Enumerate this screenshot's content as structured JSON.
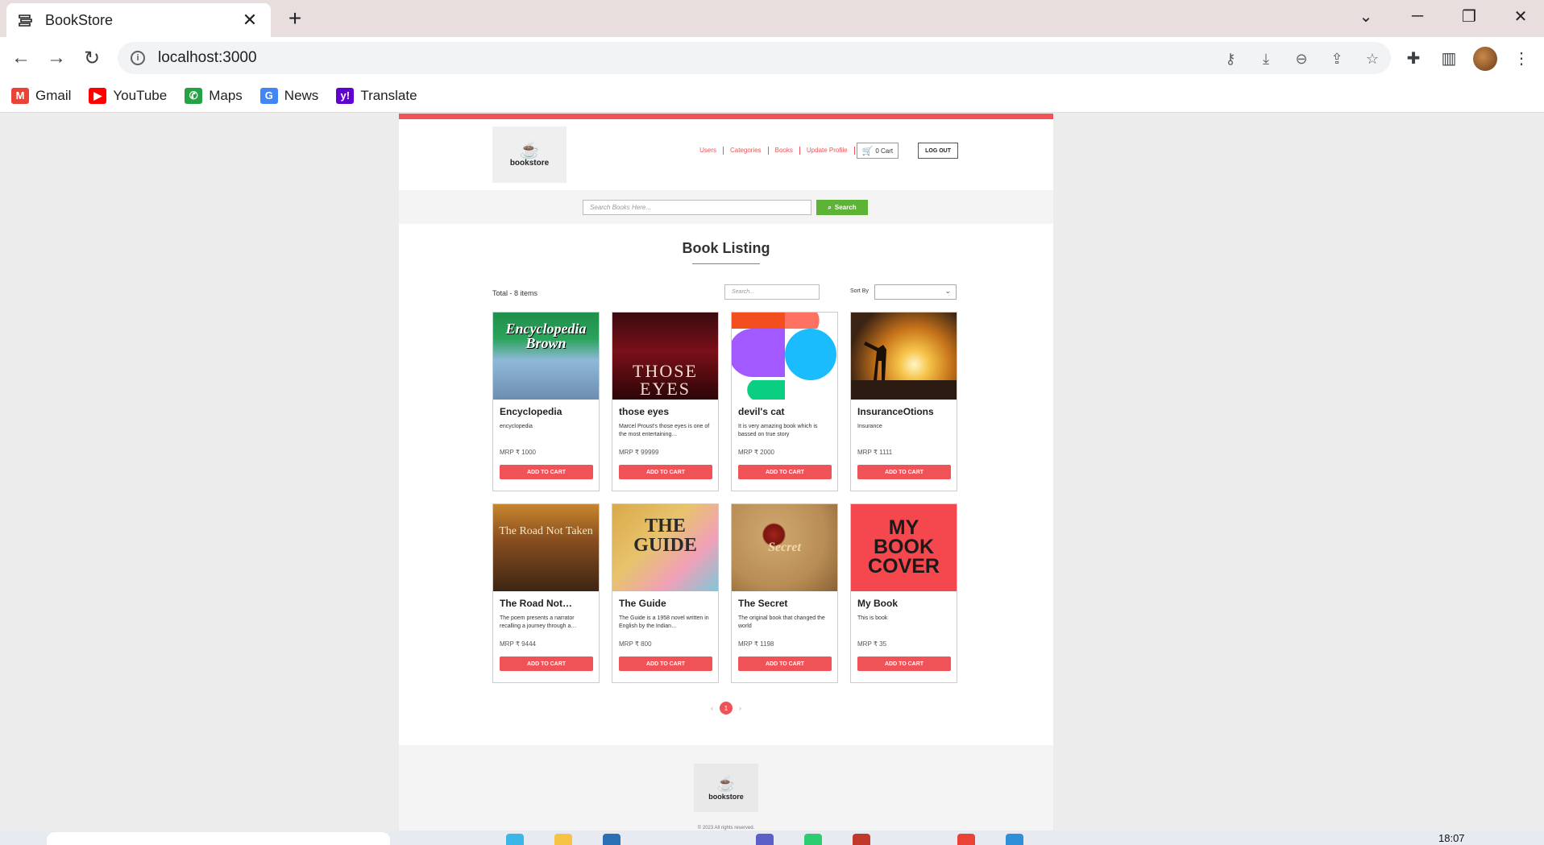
{
  "browser": {
    "tab_title": "BookStore",
    "url": "localhost:3000",
    "bookmarks": [
      {
        "label": "Gmail",
        "icon": "gmail-icon",
        "glyph": "M",
        "color": "#ea4335"
      },
      {
        "label": "YouTube",
        "icon": "youtube-icon",
        "glyph": "▶",
        "color": "#ff0000"
      },
      {
        "label": "Maps",
        "icon": "maps-icon",
        "glyph": "✆",
        "color": "#25a244"
      },
      {
        "label": "News",
        "icon": "google-icon",
        "glyph": "G",
        "color": "#4285f4"
      },
      {
        "label": "Translate",
        "icon": "yahoo-icon",
        "glyph": "y!",
        "color": "#6001d2"
      }
    ]
  },
  "site": {
    "logo_text": "bookstore",
    "nav": [
      "Users",
      "Categories",
      "Books",
      "Update Profile"
    ],
    "cart_label": "0 Cart",
    "logout_label": "LOG OUT",
    "search_placeholder": "Search Books Here...",
    "search_button": "Search",
    "accent": "#ef5257",
    "search_button_color": "#5cb335"
  },
  "listing": {
    "title": "Book Listing",
    "total": "Total - 8 items",
    "filter_placeholder": "Search...",
    "sort_label": "Sort By",
    "sort_value": ""
  },
  "books": [
    {
      "title": "Encyclopedia",
      "desc": "encyclopedia",
      "price": "MRP ₹ 1000",
      "button": "ADD TO CART",
      "cover_text": "Encyclopedia Brown",
      "cover_bg": "linear-gradient(180deg,#1f8f4c 0%,#2aa35b 30%,#8fb9d9 55%,#6d8db0 100%)"
    },
    {
      "title": "those eyes",
      "desc": "Marcel Proust's those eyes is one of the most entertaining…",
      "price": "MRP ₹ 99999",
      "button": "ADD TO CART",
      "cover_text": "THOSE EYES",
      "cover_bg": "linear-gradient(180deg,#3a0a10 0%,#7a1018 45%,#2b0508 100%)"
    },
    {
      "title": "devil's cat",
      "desc": "It is very amazing book which is bassed on true story",
      "price": "MRP ₹ 2000",
      "button": "ADD TO CART",
      "cover_text": "",
      "cover_bg": "#ffffff"
    },
    {
      "title": "InsuranceOtions",
      "desc": "Insurance",
      "price": "MRP ₹ 1111",
      "button": "ADD TO CART",
      "cover_text": "",
      "cover_bg": "radial-gradient(circle at 60% 60%,#fff6c8 0%,#f6c348 18%,#c7731a 45%,#3b2414 80%)"
    },
    {
      "title": "The Road Not…",
      "desc": "The poem presents a narrator recalling a journey through a…",
      "price": "MRP ₹ 9444",
      "button": "ADD TO CART",
      "cover_text": "The Road Not Taken",
      "cover_bg": "linear-gradient(180deg,#c7862e 0%,#8a4f1f 40%,#3d2413 100%)"
    },
    {
      "title": "The Guide",
      "desc": "The Guide is a 1958 novel written in English by the Indian…",
      "price": "MRP ₹ 800",
      "button": "ADD TO CART",
      "cover_text": "THE GUIDE",
      "cover_bg": "linear-gradient(135deg,#d9a94a 0%,#e8c36c 40%,#f0a0b8 70%,#7fc7d9 100%)"
    },
    {
      "title": "The Secret",
      "desc": "The original book that changed the world",
      "price": "MRP ₹ 1198",
      "button": "ADD TO CART",
      "cover_text": "Secret",
      "cover_bg": "radial-gradient(circle at 40% 35%,#a3221c 0%,#7a1510 12%,#caa36a 14%,#b98d55 60%,#8a6236 100%)"
    },
    {
      "title": "My Book",
      "desc": "This is book",
      "price": "MRP ₹ 35",
      "button": "ADD TO CART",
      "cover_text": "MY BOOK COVER",
      "cover_bg": "#f5474e"
    }
  ],
  "pagination": {
    "prev": "‹",
    "current": "1",
    "next": "›"
  },
  "footer": {
    "logo_text": "bookstore",
    "copyright": "© 2023 All rights reserved."
  },
  "taskbar": {
    "time": "18:07"
  }
}
